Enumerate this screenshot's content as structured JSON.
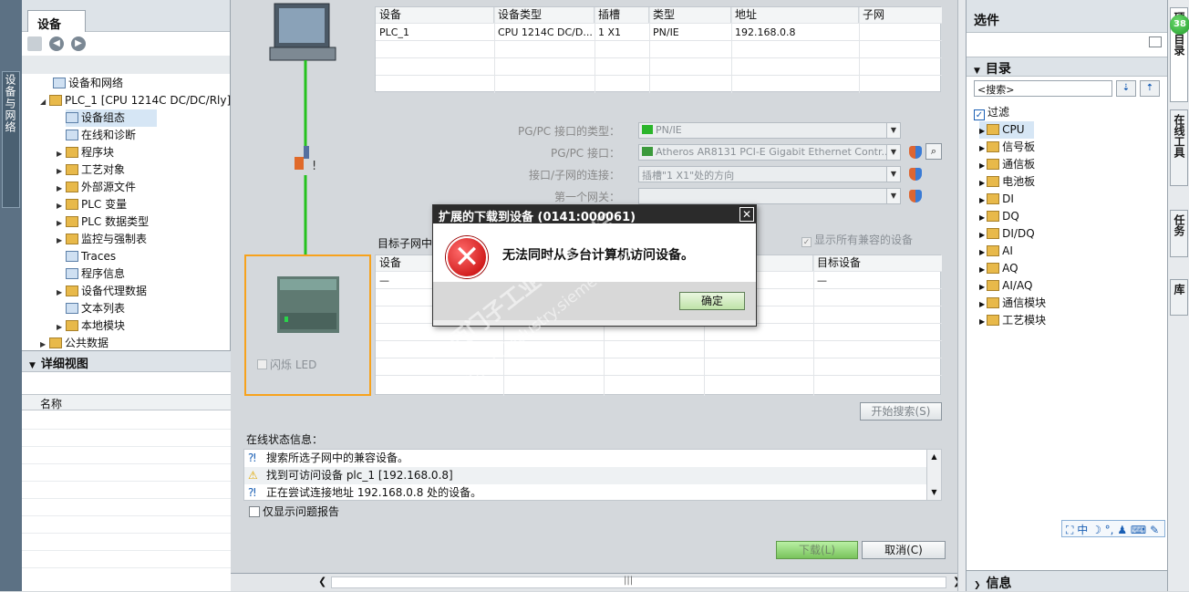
{
  "left_strip": {
    "label": "设备与网络"
  },
  "project_tree": {
    "tab": "设备",
    "items": [
      {
        "label": "设备和网络",
        "level": 2
      },
      {
        "label": "PLC_1 [CPU 1214C DC/DC/Rly]",
        "level": 1
      },
      {
        "label": "设备组态",
        "level": 3
      },
      {
        "label": "在线和诊断",
        "level": 3
      },
      {
        "label": "程序块",
        "level": 3
      },
      {
        "label": "工艺对象",
        "level": 3
      },
      {
        "label": "外部源文件",
        "level": 3
      },
      {
        "label": "PLC 变量",
        "level": 3
      },
      {
        "label": "PLC 数据类型",
        "level": 3
      },
      {
        "label": "监控与强制表",
        "level": 3
      },
      {
        "label": "Traces",
        "level": 3
      },
      {
        "label": "程序信息",
        "level": 3
      },
      {
        "label": "设备代理数据",
        "level": 3
      },
      {
        "label": "文本列表",
        "level": 3
      },
      {
        "label": "本地模块",
        "level": 3
      },
      {
        "label": "公共数据",
        "level": 1
      }
    ]
  },
  "detail_view": {
    "title": "详细视图",
    "col_name": "名称"
  },
  "device_table": {
    "headers": [
      "设备",
      "设备类型",
      "插槽",
      "类型",
      "地址",
      "子网"
    ],
    "rows": [
      [
        "PLC_1",
        "CPU 1214C DC/D...",
        "1 X1",
        "PN/IE",
        "192.168.0.8",
        ""
      ]
    ]
  },
  "pgpc": {
    "type_label": "PG/PC 接口的类型：",
    "type_value": "PN/IE",
    "iface_label": "PG/PC 接口：",
    "iface_value": "Atheros AR8131 PCI-E Gigabit Ethernet Contr...",
    "conn_label": "接口/子网的连接：",
    "conn_value": "插槽\"1 X1\"处的方向",
    "gw_label": "第一个网关：",
    "gw_value": ""
  },
  "target": {
    "subnet_label": "目标子网中",
    "show_all": "显示所有兼容的设备",
    "headers": [
      "设备",
      "",
      "",
      "",
      "目标设备"
    ],
    "row": [
      "—",
      "",
      "",
      "",
      "—"
    ]
  },
  "flash_led": "闪烁 LED",
  "start_search": "开始搜索(S)",
  "online_status": {
    "title": "在线状态信息：",
    "lines": [
      "搜索所选子网中的兼容设备。",
      "找到可访问设备 plc_1 [192.168.0.8]",
      "正在尝试连接地址 192.168.0.8 处的设备。"
    ],
    "only_problems": "仅显示问题报告"
  },
  "buttons": {
    "download": "下载(L)",
    "cancel": "取消(C)"
  },
  "dialog": {
    "title": "扩展的下载到设备 (0141:000061)",
    "message": "无法同时从多台计算机访问设备。",
    "ok": "确定"
  },
  "watermark": {
    "line1": "西门子工业 技术论坛",
    "line2": "support.industry.siemens.com/cs"
  },
  "right_panel": {
    "title": "选件",
    "catalog": "目录",
    "search_placeholder": "<搜索>",
    "filter": "过滤",
    "items": [
      "CPU",
      "信号板",
      "通信板",
      "电池板",
      "DI",
      "DQ",
      "DI/DQ",
      "AI",
      "AQ",
      "AI/AQ",
      "通信模块",
      "工艺模块"
    ],
    "info": "信息"
  },
  "right_tabs": [
    "硬件目录",
    "在线工具",
    "任务",
    "库"
  ],
  "badge": "38",
  "ime": "中"
}
